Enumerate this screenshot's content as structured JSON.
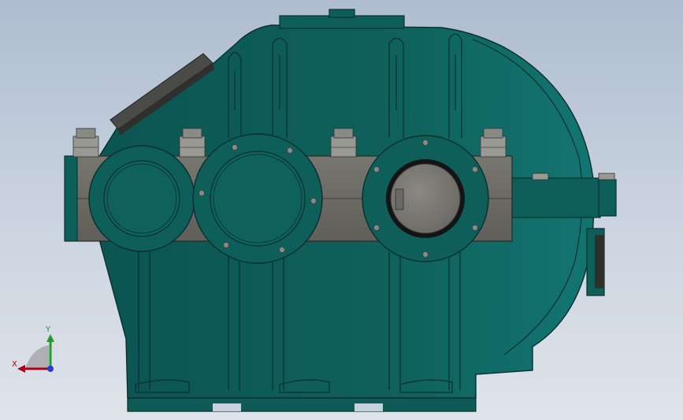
{
  "colors": {
    "background_top": "#aebdd0",
    "background_bottom": "#dfe4ea",
    "housing": "#0e5e5a",
    "housing_edge": "#0a2f2d",
    "flange_band": "#6b6a63",
    "bolt": "#9a9a94",
    "bearing_face": "#7a7873",
    "axis_x": "#b00018",
    "axis_y": "#1f9e2c",
    "axis_z": "#2a3bd8"
  },
  "triad": {
    "x_label": "X",
    "y_label": "Y"
  }
}
